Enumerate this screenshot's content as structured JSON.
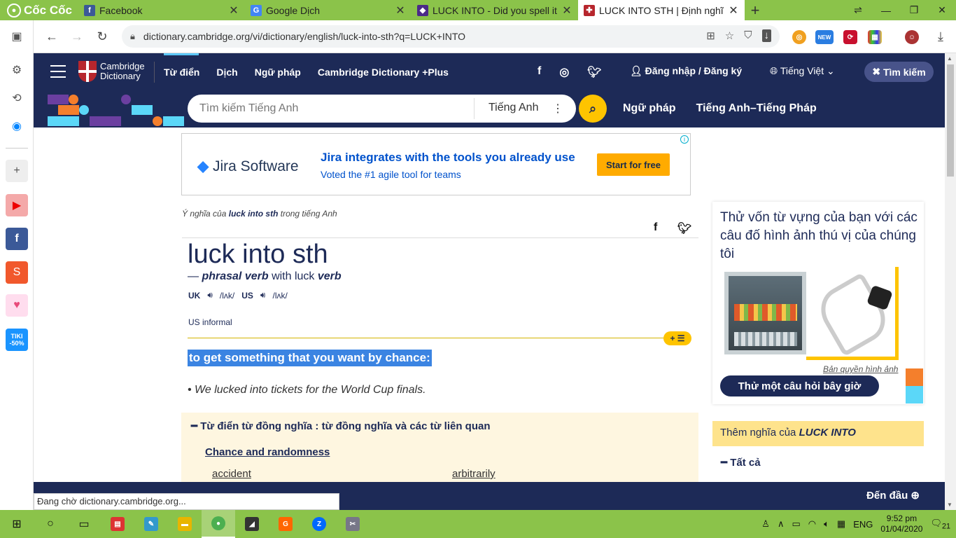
{
  "browser": {
    "brand": "Cốc Cốc",
    "tabs": [
      {
        "title": "Facebook",
        "icon": "facebook-icon",
        "color": "#3b5998",
        "glyph": "f"
      },
      {
        "title": "Google Dịch",
        "icon": "google-translate-icon",
        "color": "#4285f4",
        "glyph": "G"
      },
      {
        "title": "LUCK INTO - Did you spell it c",
        "icon": "shield-icon",
        "color": "#4b2a88",
        "glyph": "◆"
      },
      {
        "title": "LUCK INTO STH | Định nghĩa t",
        "icon": "cambridge-icon",
        "color": "#b7262d",
        "glyph": "✚"
      }
    ],
    "url": "dictionary.cambridge.org/vi/dictionary/english/luck-into-sth?q=LUCK+INTO",
    "status_text": "Đang chờ dictionary.cambridge.org...",
    "ext_new_label": "NEW"
  },
  "site": {
    "logo_line1": "Cambridge",
    "logo_line2": "Dictionary",
    "nav": [
      "Từ điển",
      "Dịch",
      "Ngữ pháp",
      "Cambridge Dictionary +Plus"
    ],
    "login": "Đăng nhập / Đăng ký",
    "language": "Tiếng Việt",
    "search_toggle": "Tìm kiếm",
    "search_placeholder": "Tìm kiếm Tiếng Anh",
    "search_lang": "Tiếng Anh",
    "sublinks": [
      "Ngữ pháp",
      "Tiếng Anh–Tiếng Pháp"
    ]
  },
  "ad": {
    "brand": "Jira Software",
    "headline": "Jira integrates with the tools you already use",
    "subline": "Voted the #1 agile tool for teams",
    "cta": "Start for free",
    "info": "i"
  },
  "entry": {
    "meaning_prefix": "Ý nghĩa của",
    "meaning_word": "luck into sth",
    "meaning_suffix": "trong tiếng Anh",
    "headword": "luck into sth",
    "dash": "—",
    "pos": "phrasal verb",
    "with": "with",
    "base_word": "luck",
    "base_pos": "verb",
    "uk_label": "UK",
    "uk_ipa": "/lʌk/",
    "us_label": "US",
    "us_ipa": "/lʌk/",
    "usage": "US informal",
    "definition": "to get something that you want by chance:",
    "example": "We lucked into tickets for the World Cup finals."
  },
  "thesaurus": {
    "heading": "Từ điển từ đồng nghĩa : từ đồng nghĩa và các từ liên quan",
    "category": "Chance and randomness",
    "words": [
      "accident",
      "arbitrarily"
    ]
  },
  "sidebar_right": {
    "quiz_text": "Thử vốn từ vựng của bạn với các câu đố hình ảnh thú vị của chúng tôi",
    "credit": "Bản quyền hình ảnh",
    "quiz_button": "Thử một câu hỏi bây giờ",
    "more_prefix": "Thêm nghĩa của",
    "more_word": "LUCK INTO",
    "all_label": "Tất cả"
  },
  "footer": {
    "back_to_top": "Đến đầu"
  },
  "taskbar": {
    "lang": "ENG",
    "time": "9:52 pm",
    "date": "01/04/2020",
    "notifications": "21"
  }
}
